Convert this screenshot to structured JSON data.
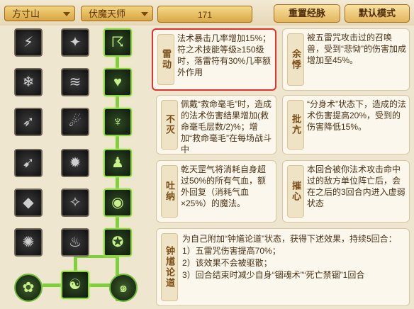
{
  "filters": {
    "school": "方寸山",
    "branch": "伏魔天师",
    "points": "171"
  },
  "buttons": {
    "reset": "重置经脉",
    "default": "默认模式"
  },
  "skills": [
    {
      "name": "雷动",
      "desc": "法术暴击几率增加15%；符之术技能等级≥150级时，落雷符有30%几率额外作用"
    },
    {
      "name": "余悸",
      "desc": "被五雷咒攻击过的召唤兽，受到“悲恸”的伤害加成增加至45%。"
    },
    {
      "name": "不灭",
      "desc": "佩戴“救命毫毛”时，造成的法术伤害结果增加(救命毫毛层数/2)%；增加“救命毫毛”在每场战斗中"
    },
    {
      "name": "批亢",
      "desc": "“分身术”状态下，造成的法术伤害提高20%，受到的伤害降低15%。"
    },
    {
      "name": "吐纳",
      "desc": "乾天罡气将消耗自身超过50%的所有气血，额外回复（消耗气血×25%）的魔法。"
    },
    {
      "name": "摧心",
      "desc": "本回合被你法术攻击命中过的敌方单位阵亡后，会在之后的3回合内进入虚弱状态"
    },
    {
      "name": "钟馗论道",
      "desc": "为自己附加“钟馗论道”状态，获得下述效果，持续5回合：\n1）五雷咒伤害提高70%；\n2）该效果不会被驱散；\n3）回合结束时减少自身“锢魂术”“死亡禁锢”1回合"
    }
  ],
  "colors": {
    "selected_border": "#e0332f",
    "active_icon_border": "#8bd243",
    "background": "#efe6cf"
  }
}
